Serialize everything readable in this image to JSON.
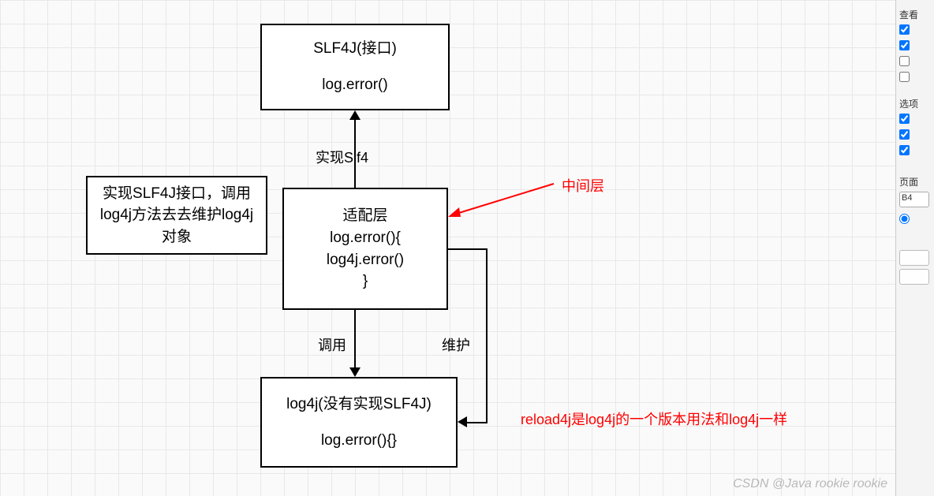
{
  "nodes": {
    "slf4j": {
      "line1": "SLF4J(接口)",
      "line2": "log.error()"
    },
    "impl": {
      "text": "实现SLF4J接口，调用log4j方法去去维护log4j对象"
    },
    "adapter": {
      "l1": "适配层",
      "l2": "log.error(){",
      "l3": "log4j.error()",
      "l4": "}"
    },
    "log4j": {
      "line1": "log4j(没有实现SLF4J)",
      "line2": "log.error(){}"
    }
  },
  "edges": {
    "up": {
      "label": "实现Slf4"
    },
    "down": {
      "label": "调用"
    },
    "loop": {
      "label": "维护"
    }
  },
  "annotations": {
    "mid": "中间层",
    "reload": "reload4j是log4j的一个版本用法和log4j一样"
  },
  "sidebar": {
    "section1": "查看",
    "section2": "选项",
    "section3": "页面",
    "pageSize": "B4"
  },
  "watermark": "CSDN @Java rookie rookie"
}
